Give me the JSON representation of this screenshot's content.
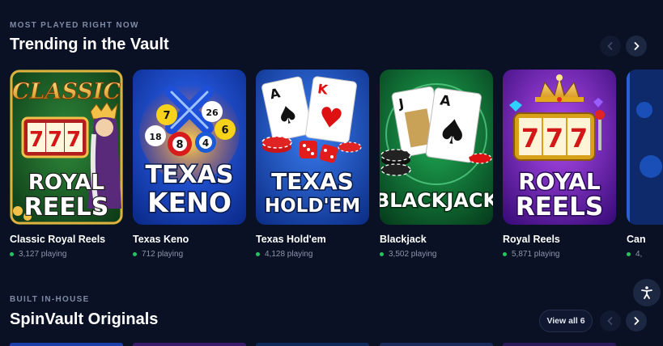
{
  "trending": {
    "eyebrow": "MOST PLAYED RIGHT NOW",
    "title": "Trending in the Vault",
    "games": [
      {
        "title": "Classic Royal Reels",
        "playing": "3,127 playing",
        "art_line1": "ROYAL",
        "art_line2": "REELS",
        "art_top": "CLASSIC"
      },
      {
        "title": "Texas Keno",
        "playing": "712 playing",
        "art_line1": "TEXAS",
        "art_line2": "KENO"
      },
      {
        "title": "Texas Hold'em",
        "playing": "4,128 playing",
        "art_line1": "TEXAS",
        "art_line2": "HOLD'EM"
      },
      {
        "title": "Blackjack",
        "playing": "3,502 playing",
        "art_line1": "BLACKJACK"
      },
      {
        "title": "Royal Reels",
        "playing": "5,871 playing",
        "art_line1": "ROYAL",
        "art_line2": "REELS"
      },
      {
        "title": "Can",
        "playing": "4,"
      }
    ],
    "prev_icon": "chevron-left-icon",
    "next_icon": "chevron-right-icon"
  },
  "originals": {
    "eyebrow": "BUILT IN-HOUSE",
    "title": "SpinVault Originals",
    "view_all": "View all 6"
  },
  "colors": {
    "background": "#0a1124",
    "live_dot": "#22c55e",
    "muted_text": "#8b95ad"
  },
  "accessibility_icon": "accessibility-icon"
}
